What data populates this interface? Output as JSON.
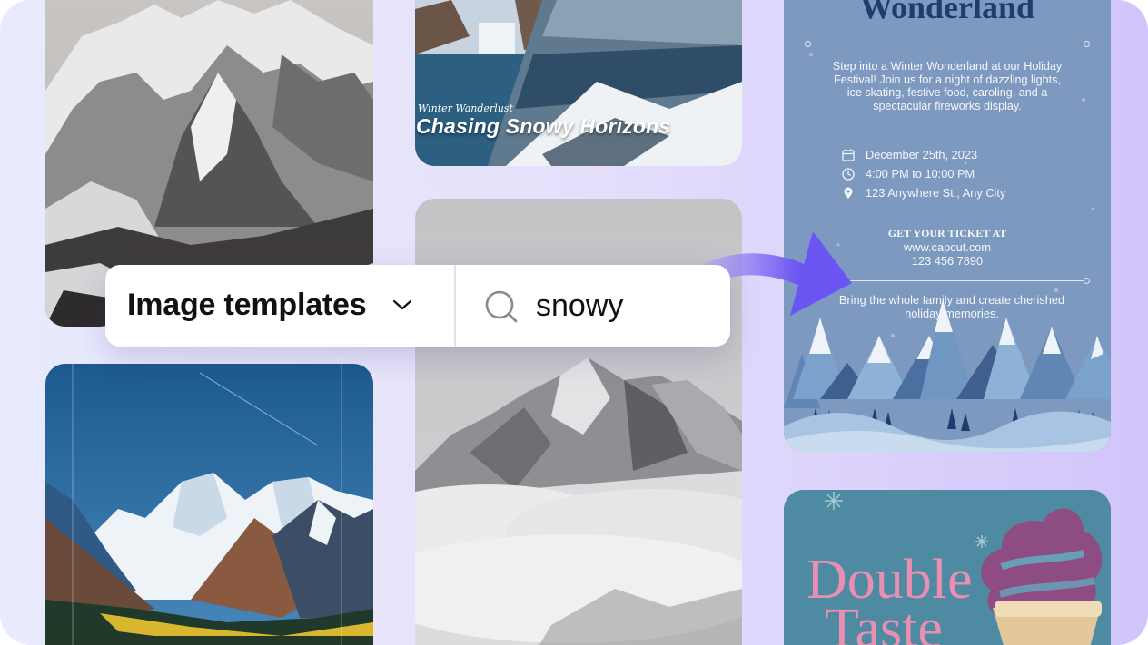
{
  "search_bar": {
    "template_type": "Image templates",
    "query": "snowy"
  },
  "cards": {
    "travel": {
      "subtitle": "Winter Wanderlust",
      "title": "Chasing Snowy Horizons"
    },
    "festival": {
      "title": "Wonderland",
      "description": "Step into a Winter Wonderland at our Holiday Festival! Join us for a night of dazzling lights, ice skating, festive food, caroling, and a spectacular fireworks display.",
      "date": "December 25th, 2023",
      "time": "4:00 PM to 10:00 PM",
      "address": "123 Anywhere St., Any City",
      "ticket_label": "GET YOUR TICKET AT",
      "website": "www.capcut.com",
      "phone": "123 456 7890",
      "footer": "Bring the whole family and create cherished holiday memories."
    },
    "ice_cream": {
      "line1": "Double",
      "line2": "Taste"
    }
  },
  "colors": {
    "arrow": "#6b55f2",
    "poster_bg": "#7d99bf",
    "poster_title": "#1d3d6e",
    "ice_cream_bg": "#4e8aa2",
    "ice_cream_text": "#e98fb2"
  },
  "icons": [
    "chevron-down-icon",
    "search-icon",
    "calendar-icon",
    "clock-icon",
    "location-pin-icon",
    "curved-arrow-icon"
  ]
}
